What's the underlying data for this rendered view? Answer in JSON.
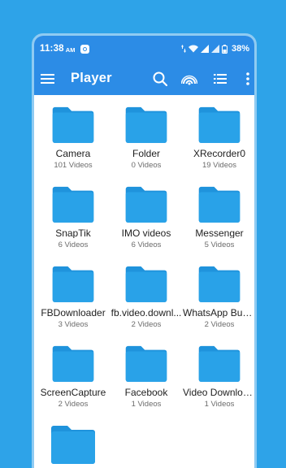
{
  "status_bar": {
    "time": "11:38",
    "ampm": "AM",
    "battery": "38%"
  },
  "app_bar": {
    "title": "Player",
    "actions": [
      "search-icon",
      "cast-icon",
      "list-view-icon",
      "more-vert-icon"
    ]
  },
  "colors": {
    "background": "#2ea3e8",
    "primary": "#2c8ce6",
    "folder": "#29a2e8",
    "folder_tab": "#1f93dc"
  },
  "folders": [
    {
      "name": "Camera",
      "count": "101 Videos"
    },
    {
      "name": "Folder",
      "count": "0 Videos"
    },
    {
      "name": "XRecorder0",
      "count": "19 Videos"
    },
    {
      "name": "SnapTik",
      "count": "6 Videos"
    },
    {
      "name": "IMO videos",
      "count": "6 Videos"
    },
    {
      "name": "Messenger",
      "count": "5 Videos"
    },
    {
      "name": "FBDownloader",
      "count": "3 Videos"
    },
    {
      "name": "fb.video.downl...",
      "count": "2 Videos"
    },
    {
      "name": "WhatsApp Busi...",
      "count": "2 Videos"
    },
    {
      "name": "ScreenCapture",
      "count": "2 Videos"
    },
    {
      "name": "Facebook",
      "count": "1 Videos"
    },
    {
      "name": "Video Downloa...",
      "count": "1 Videos"
    },
    {
      "name": "",
      "count": ""
    }
  ]
}
